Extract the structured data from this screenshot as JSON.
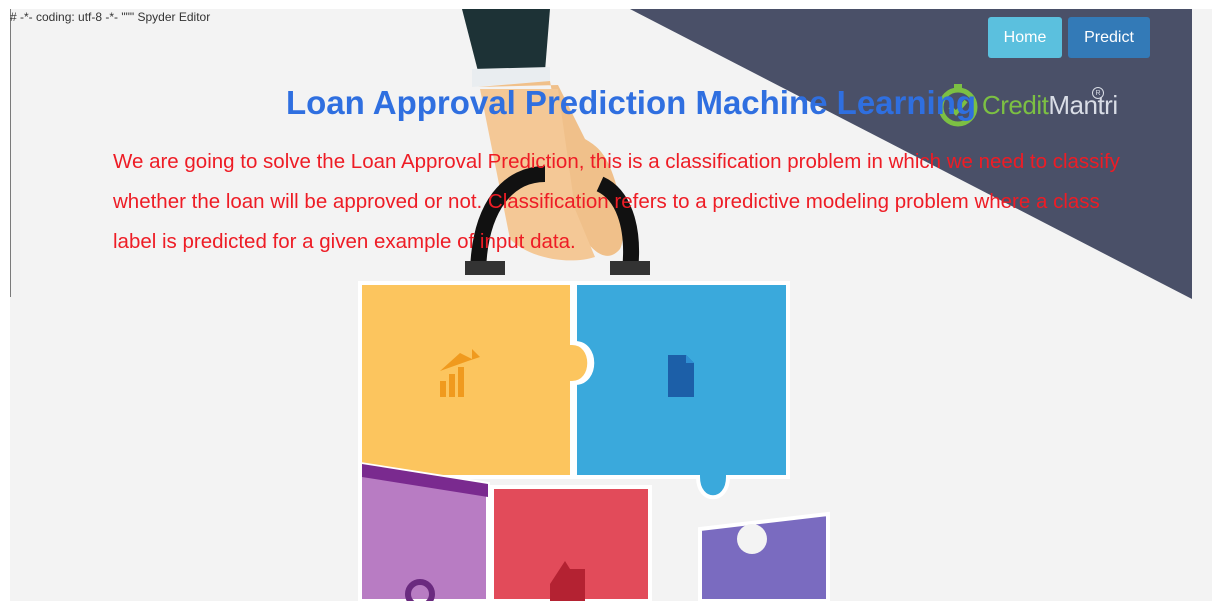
{
  "header_comment": "# -*- coding: utf-8 -*- \"\"\" Spyder Editor",
  "nav": {
    "home_label": "Home",
    "predict_label": "Predict"
  },
  "title": "Loan Approval Prediction Machine Learning",
  "description": "We are going to solve the Loan Approval Prediction, this is a classification problem in which we need to classify whether the loan will be approved or not. Classification refers to a predictive modeling problem where a class label is predicted for a given example of input data.",
  "brand": {
    "part1": "Credit",
    "part2": "Mantri"
  },
  "colors": {
    "title": "#2f6fe0",
    "description": "#ee1c25",
    "home_button": "#5bc0de",
    "predict_button": "#337ab7",
    "banner_dark": "#4a5068"
  }
}
